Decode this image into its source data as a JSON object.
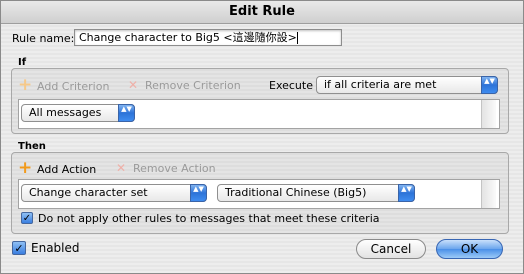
{
  "window": {
    "title": "Edit Rule"
  },
  "rule_name": {
    "label": "Rule name:",
    "value": "Change character to Big5 <這邊隨你設>"
  },
  "if_section": {
    "heading": "If",
    "add_criterion": "Add Criterion",
    "remove_criterion": "Remove Criterion",
    "execute_label": "Execute",
    "execute_value": "if all criteria are met",
    "criterion_value": "All messages"
  },
  "then_section": {
    "heading": "Then",
    "add_action": "Add Action",
    "remove_action": "Remove Action",
    "action_value": "Change character set",
    "charset_value": "Traditional Chinese (Big5)",
    "stop_rules_label": "Do not apply other rules to messages that meet these criteria",
    "stop_rules_checked": true
  },
  "footer": {
    "enabled_label": "Enabled",
    "enabled_checked": true,
    "cancel_label": "Cancel",
    "ok_label": "OK"
  },
  "icons": {
    "popup_arrows": "▲▼",
    "add": "+",
    "remove": "✕",
    "check": "✓"
  }
}
